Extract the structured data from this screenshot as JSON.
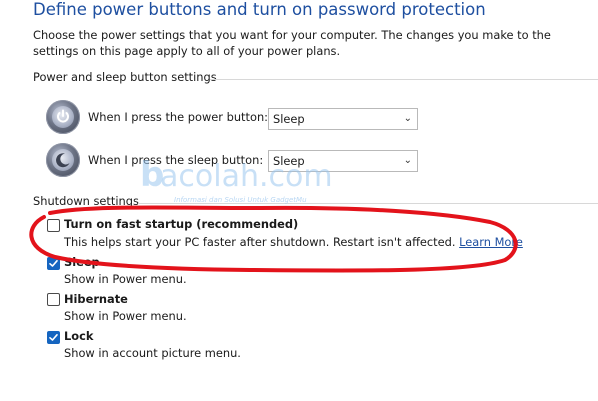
{
  "page": {
    "title": "Define power buttons and turn on password protection",
    "description": "Choose the power settings that you want for your computer. The changes you make to the settings on this page apply to all of your power plans."
  },
  "power_sleep_section": {
    "header": "Power and sleep button settings",
    "rows": [
      {
        "label": "When I press the power button:",
        "value": "Sleep",
        "icon": "power-button-icon"
      },
      {
        "label": "When I press the sleep button:",
        "value": "Sleep",
        "icon": "sleep-button-icon"
      }
    ]
  },
  "shutdown_section": {
    "header": "Shutdown settings",
    "options": [
      {
        "label": "Turn on fast startup (recommended)",
        "checked": false,
        "description": "This helps start your PC faster after shutdown. Restart isn't affected.",
        "link": "Learn More"
      },
      {
        "label": "Sleep",
        "checked": true,
        "description": "Show in Power menu."
      },
      {
        "label": "Hibernate",
        "checked": false,
        "description": "Show in Power menu."
      },
      {
        "label": "Lock",
        "checked": true,
        "description": "Show in account picture menu."
      }
    ]
  },
  "watermark": {
    "brand": "acolah.com",
    "tagline": "Informasi dan Solusi Untuk GadgetMu"
  },
  "colors": {
    "title": "#1e4fa0",
    "checkbox_checked": "#1565c0",
    "annotation": "#e3131b"
  }
}
